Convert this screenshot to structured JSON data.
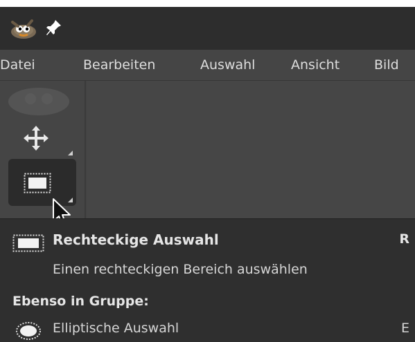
{
  "titlebar": {
    "app_icon": "gimp-wilber-icon",
    "pin_icon": "pin-icon"
  },
  "menubar": {
    "items": [
      "Datei",
      "Bearbeiten",
      "Auswahl",
      "Ansicht",
      "Bild"
    ]
  },
  "toolbox": {
    "tools": [
      {
        "name": "move-tool",
        "icon": "move-arrows-icon"
      },
      {
        "name": "rect-select-tool",
        "icon": "rect-select-icon",
        "active": true
      }
    ]
  },
  "tooltip": {
    "title": "Rechteckige Auswahl",
    "shortcut": "R",
    "description": "Einen rechteckigen Bereich auswählen",
    "group_heading": "Ebenso in Gruppe:",
    "alternatives": [
      {
        "label": "Elliptische Auswahl",
        "shortcut": "E",
        "icon": "ellipse-select-icon"
      }
    ]
  },
  "colors": {
    "titlebar": "#2d2d2d",
    "menubar": "#454545",
    "tooltip_bg": "#2f2f2f",
    "text": "#dedede"
  }
}
